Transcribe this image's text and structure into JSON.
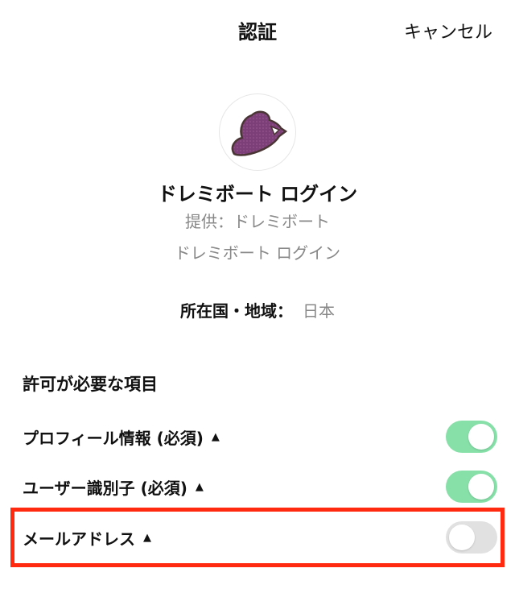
{
  "header": {
    "title": "認証",
    "cancel_label": "キャンセル"
  },
  "app": {
    "logo_icon": "app-logo-icon",
    "name": "ドレミボート ログイン",
    "provider": "提供：ドレミボート",
    "subtitle": "ドレミボート ログイン"
  },
  "region": {
    "label": "所在国・地域：",
    "value": "日本"
  },
  "permissions": {
    "title": "許可が必要な項目",
    "items": [
      {
        "label": "プロフィール情報 (必須)",
        "enabled": true
      },
      {
        "label": "ユーザー識別子 (必須)",
        "enabled": true
      },
      {
        "label": "メールアドレス",
        "enabled": false
      }
    ]
  },
  "colors": {
    "toggle_on": "#86e0a8",
    "toggle_off": "#e1e1e1",
    "highlight": "#ff2a10"
  }
}
